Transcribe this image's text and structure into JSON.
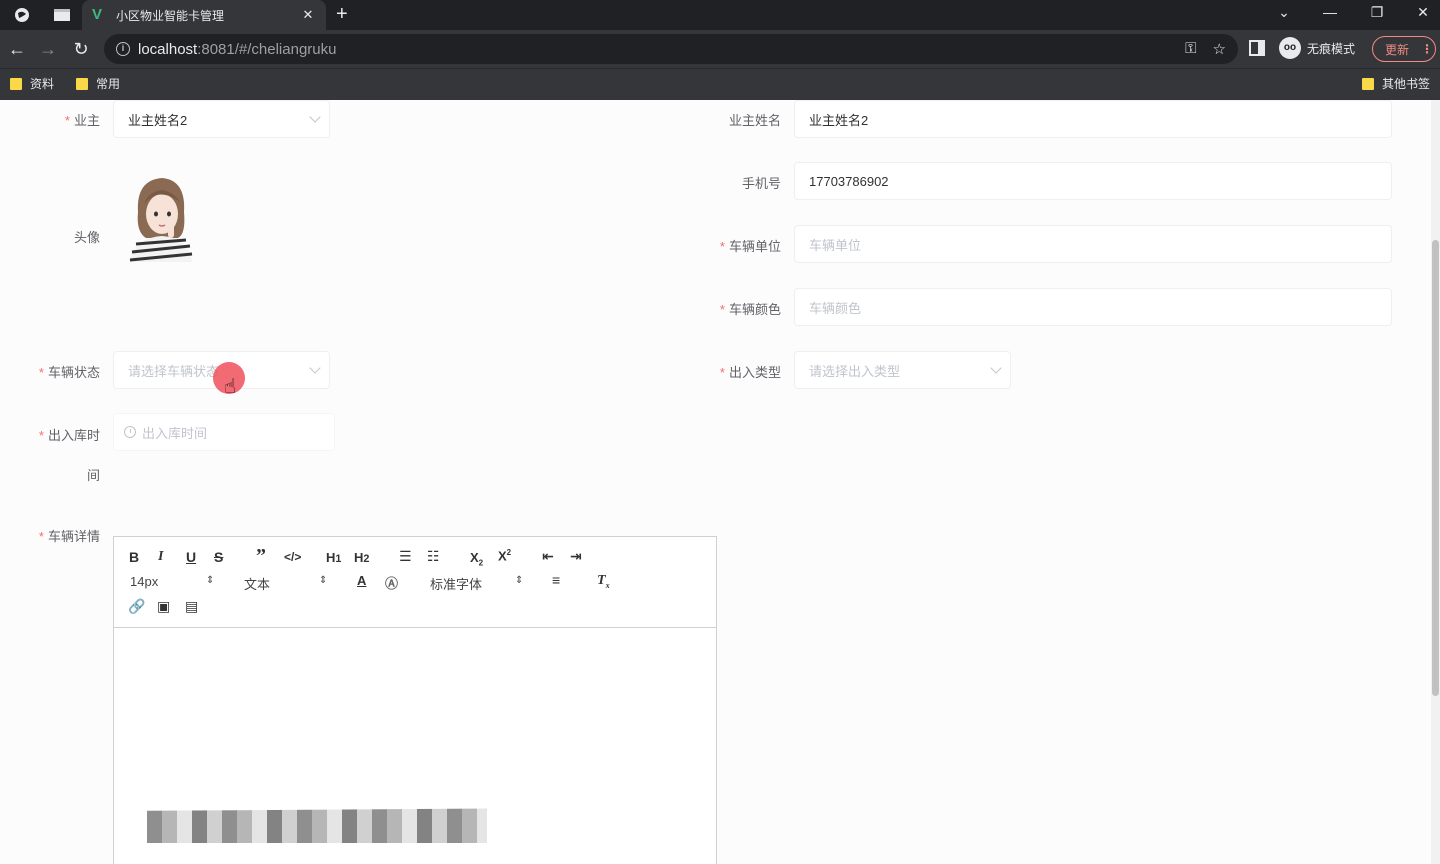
{
  "browser": {
    "tab_title": "小区物业智能卡管理",
    "url_host": "localhost",
    "url_rest": ":8081/#/cheliangruku",
    "incognito_label": "无痕模式",
    "update_label": "更新",
    "bookmarks": [
      "资料",
      "常用"
    ],
    "other_bookmarks": "其他书签"
  },
  "form": {
    "owner": {
      "label": "业主",
      "value": "业主姓名2"
    },
    "owner_name": {
      "label": "业主姓名",
      "value": "业主姓名2"
    },
    "avatar": {
      "label": "头像"
    },
    "phone": {
      "label": "手机号",
      "value": "17703786902"
    },
    "vehicle_unit": {
      "label": "车辆单位",
      "placeholder": "车辆单位"
    },
    "vehicle_color": {
      "label": "车辆颜色",
      "placeholder": "车辆颜色"
    },
    "vehicle_status": {
      "label": "车辆状态",
      "placeholder": "请选择车辆状态"
    },
    "inout_type": {
      "label": "出入类型",
      "placeholder": "请选择出入类型"
    },
    "inout_time": {
      "label_line1": "出入库时",
      "label_line2": "间",
      "placeholder": "出入库时间"
    },
    "vehicle_detail": {
      "label": "车辆详情"
    }
  },
  "editor": {
    "font_size": "14px",
    "block_type": "文本",
    "font_family": "标准字体"
  }
}
